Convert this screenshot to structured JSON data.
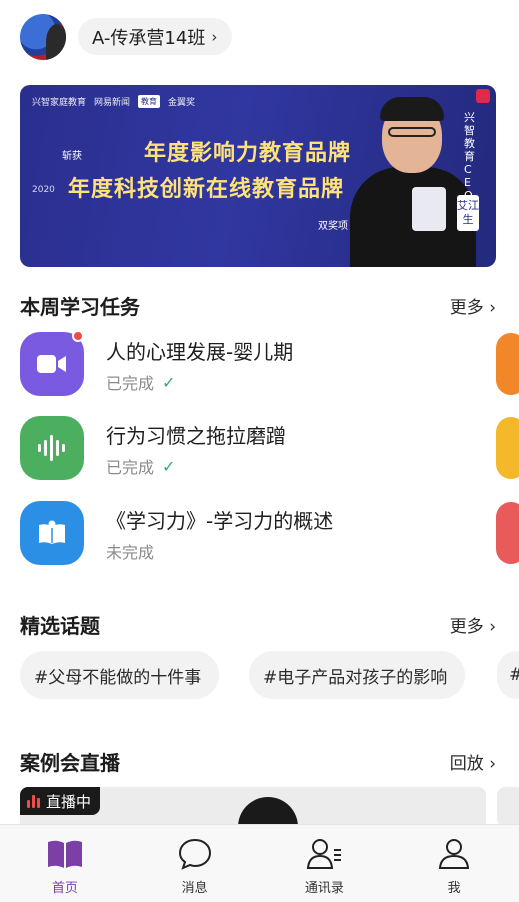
{
  "header": {
    "class_name": "A-传承营14班",
    "chevron": "›"
  },
  "banner": {
    "logo_1": "兴智家庭教育",
    "logo_2": "网易新闻",
    "logo_2_tag": "教育",
    "logo_3": "金翼奖",
    "year": "2020",
    "won": "斩获",
    "headline_1": "年度影响力教育品牌",
    "headline_2": "年度科技创新在线教育品牌",
    "award": "双奖项",
    "title_vertical": "兴智教育CEO",
    "person_name": "艾江生",
    "mic_label": "兴智家庭教育"
  },
  "tasks_section": {
    "title": "本周学习任务",
    "more": "更多",
    "items": [
      {
        "title": "人的心理发展-婴儿期",
        "status": "已完成",
        "done": true,
        "icon": "video-icon",
        "color": "#7a5ae0",
        "unread": true
      },
      {
        "title": "行为习惯之拖拉磨蹭",
        "status": "已完成",
        "done": true,
        "icon": "audio-wave-icon",
        "color": "#4cae5f",
        "unread": false
      },
      {
        "title": "《学习力》-学习力的概述",
        "status": "未完成",
        "done": false,
        "icon": "book-icon",
        "color": "#2c8fe6",
        "unread": false
      }
    ],
    "peek_colors": [
      "#f2872a",
      "#f5b82b",
      "#e95a5a"
    ]
  },
  "topics_section": {
    "title": "精选话题",
    "more": "更多",
    "topics": [
      "#父母不能做的十件事",
      "#电子产品对孩子的影响",
      "#"
    ]
  },
  "live_section": {
    "title": "案例会直播",
    "more": "回放",
    "badge": "直播中"
  },
  "tabbar": {
    "tabs": [
      {
        "label": "首页",
        "icon": "book-open-icon",
        "active": true
      },
      {
        "label": "消息",
        "icon": "chat-bubble-icon",
        "active": false
      },
      {
        "label": "通讯录",
        "icon": "contacts-icon",
        "active": false
      },
      {
        "label": "我",
        "icon": "person-icon",
        "active": false
      }
    ]
  },
  "colors": {
    "accent": "#7b3fa6",
    "done_check": "#2fb067",
    "unread_dot": "#f04b4b",
    "banner_bg": "#2a2f8e",
    "banner_headline": "#ffe27a"
  }
}
